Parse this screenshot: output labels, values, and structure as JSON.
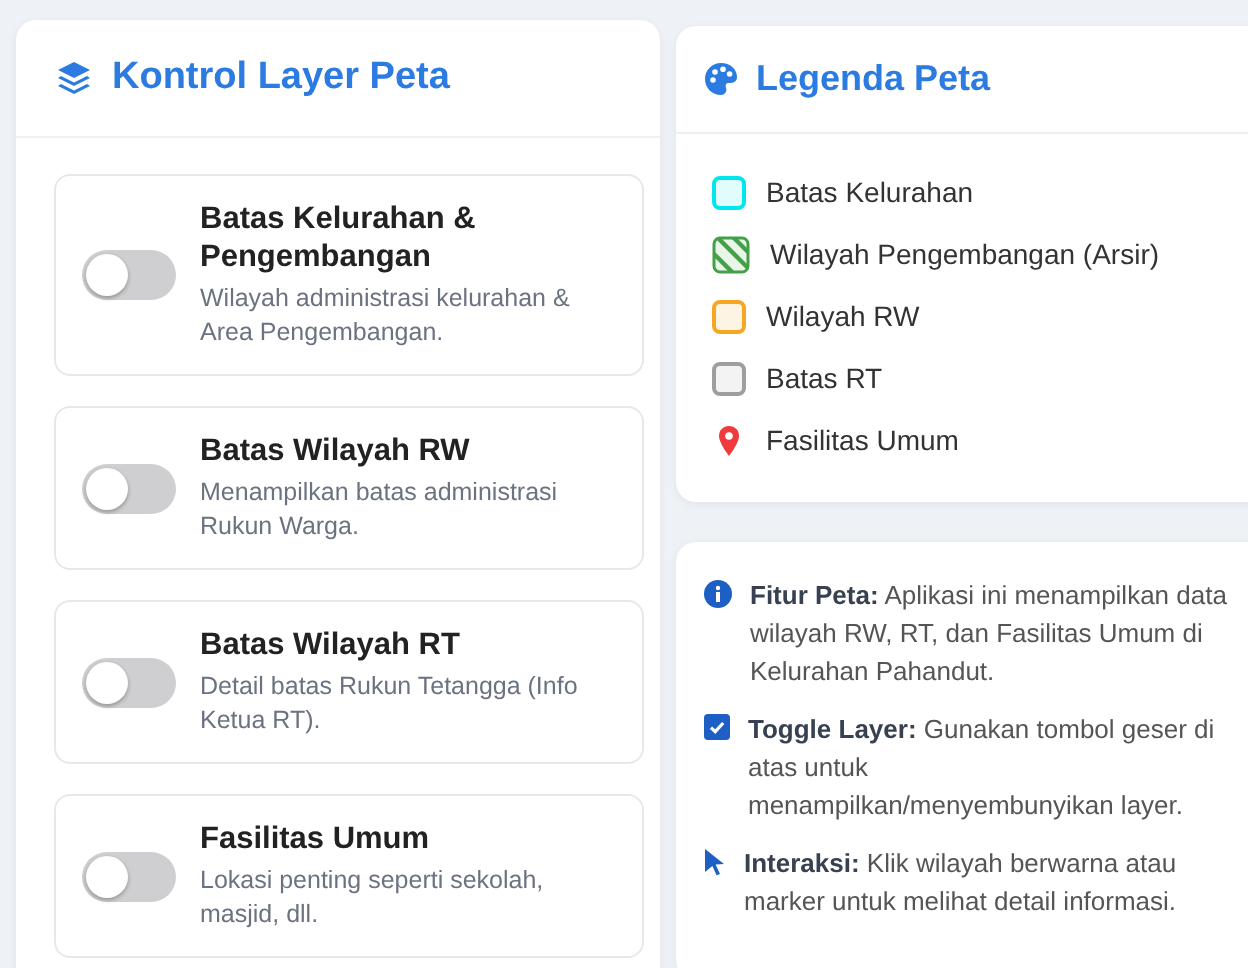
{
  "layer_panel": {
    "title": "Kontrol Layer Peta",
    "layers": [
      {
        "title": "Batas Kelurahan & Pengembangan",
        "description": "Wilayah administrasi kelurahan & Area Pengembangan.",
        "on": false
      },
      {
        "title": "Batas Wilayah RW",
        "description": "Menampilkan batas administrasi Rukun Warga.",
        "on": false
      },
      {
        "title": "Batas Wilayah RT",
        "description": "Detail batas Rukun Tetangga (Info Ketua RT).",
        "on": false
      },
      {
        "title": "Fasilitas Umum",
        "description": "Lokasi penting seperti sekolah, masjid, dll.",
        "on": false
      }
    ]
  },
  "legend": {
    "title": "Legenda Peta",
    "items": [
      {
        "kind": "box",
        "color": "#00e5ee",
        "label": "Batas Kelurahan"
      },
      {
        "kind": "hatch",
        "color": "#43a047",
        "label": "Wilayah Pengembangan (Arsir)"
      },
      {
        "kind": "box",
        "color": "#f5a623",
        "label": "Wilayah RW"
      },
      {
        "kind": "box",
        "color": "#9e9e9e",
        "label": "Batas RT"
      },
      {
        "kind": "pin",
        "color": "#ef3b3b",
        "label": "Fasilitas Umum"
      }
    ]
  },
  "info": {
    "items": [
      {
        "kind": "info",
        "text": "**Fitur Peta:** Aplikasi ini menampilkan data wilayah RW, RT, dan Fasilitas Umum di Kelurahan Pahandut."
      },
      {
        "kind": "check",
        "text": "**Toggle Layer:** Gunakan tombol geser di atas untuk menampilkan/menyembunyikan layer."
      },
      {
        "kind": "pointer",
        "text": "**Interaksi:** Klik wilayah berwarna atau marker untuk melihat detail informasi."
      }
    ]
  }
}
